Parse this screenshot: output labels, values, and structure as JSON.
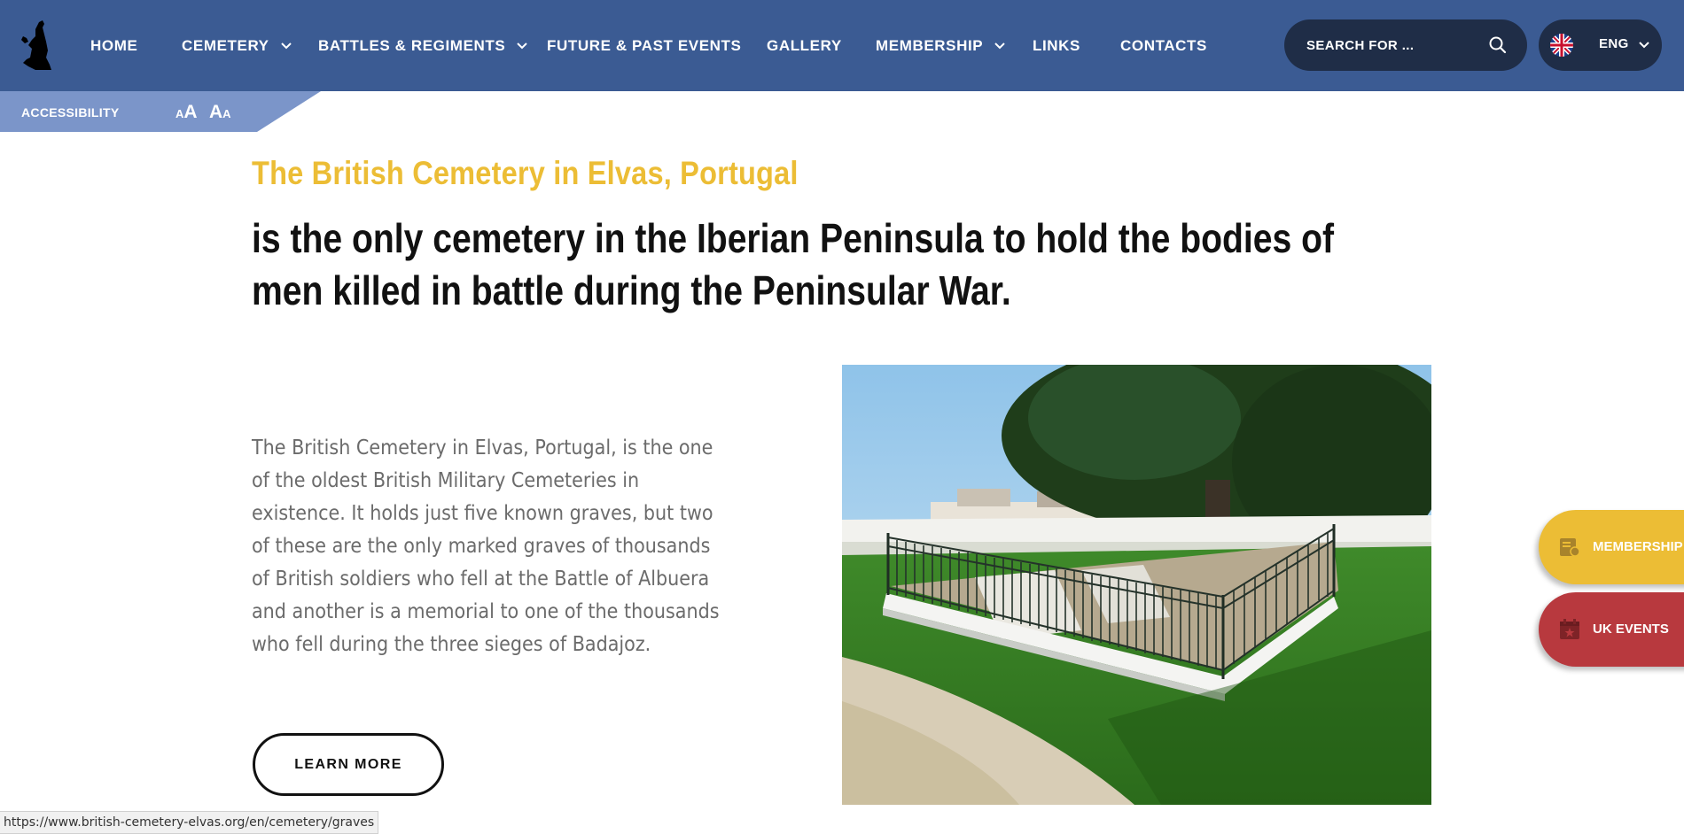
{
  "header": {
    "nav": [
      {
        "label": "HOME",
        "has_dropdown": false
      },
      {
        "label": "CEMETERY",
        "has_dropdown": true
      },
      {
        "label": "BATTLES & REGIMENTS",
        "has_dropdown": true
      },
      {
        "label": "FUTURE & PAST EVENTS",
        "has_dropdown": false
      },
      {
        "label": "GALLERY",
        "has_dropdown": false
      },
      {
        "label": "MEMBERSHIP",
        "has_dropdown": true
      },
      {
        "label": "LINKS",
        "has_dropdown": false
      },
      {
        "label": "CONTACTS",
        "has_dropdown": false
      }
    ],
    "search": {
      "placeholder": "SEARCH FOR ...",
      "icon": "search-icon"
    },
    "language": {
      "label": "ENG",
      "flag": "uk-flag-icon"
    }
  },
  "accessibility": {
    "label": "ACCESSIBILITY",
    "increase": {
      "small": "A",
      "large": "A"
    },
    "decrease": {
      "large": "A",
      "small": "A"
    }
  },
  "main": {
    "subtitle": "The British Cemetery in Elvas, Portugal",
    "headline": "is the only cemetery in the Iberian Peninsula to hold the bodies of men killed in battle during the Peninsular War.",
    "body": "The British Cemetery in Elvas, Portugal, is the one of the oldest British Military Cemeteries in existence. It holds just five known graves, but two of these are the only marked graves of thousands of British soldiers who fell at the Battle of Albuera and another is a memorial to one of the thousands who fell during the three sieges of Badajoz.",
    "cta": "LEARN MORE"
  },
  "floating": {
    "membership": {
      "label": "MEMBERSHIP",
      "icon": "membership-card-icon"
    },
    "events": {
      "label": "UK EVENTS",
      "icon": "calendar-icon"
    }
  },
  "status_url": "https://www.british-cemetery-elvas.org/en/cemetery/graves",
  "colors": {
    "header_bg": "#3b5b93",
    "accessibility_bg": "#7b95c9",
    "pill_bg": "#1f2d47",
    "accent_gold": "#ecbd35",
    "accent_red": "#b8393e"
  }
}
